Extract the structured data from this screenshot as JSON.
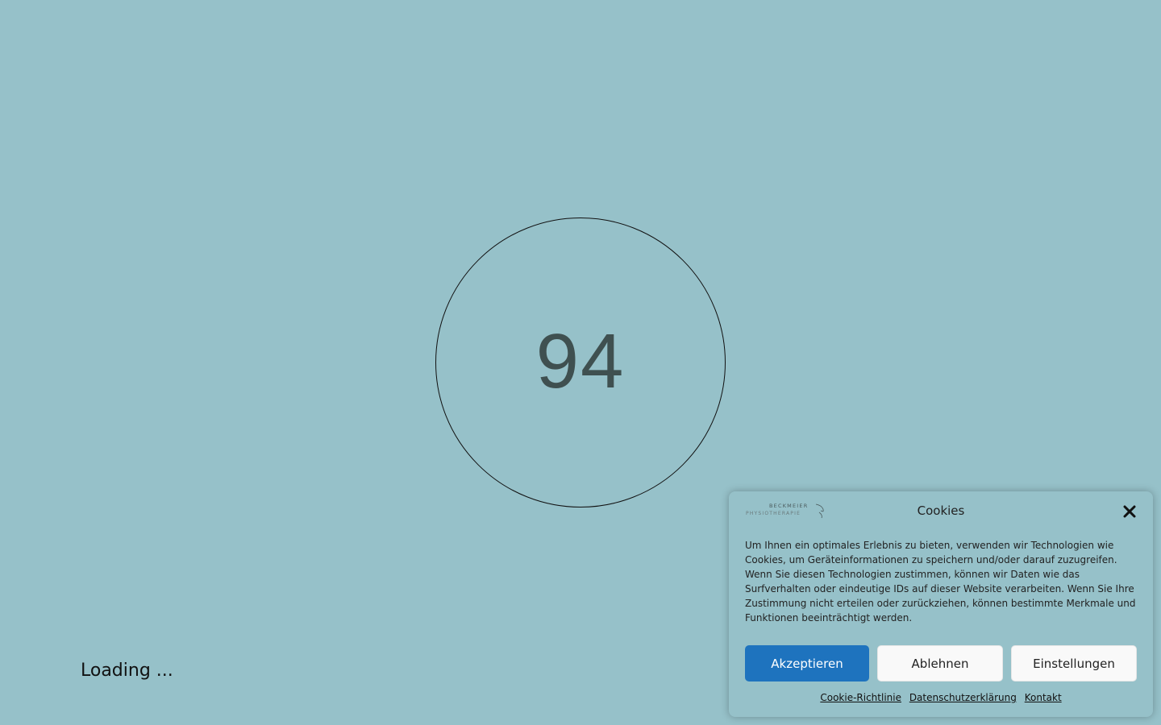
{
  "loader": {
    "percent": "94",
    "loading_text": "Loading ..."
  },
  "cookie_banner": {
    "logo_text_top": "BECKMEIER",
    "logo_text_bottom": "PHYSIOTHERAPIE",
    "title": "Cookies",
    "message": "Um Ihnen ein optimales Erlebnis zu bieten, verwenden wir Technologien wie Cookies, um Geräteinformationen zu speichern und/oder darauf zuzugreifen. Wenn Sie diesen Technologien zustimmen, können wir Daten wie das Surfverhalten oder eindeutige IDs auf dieser Website verarbeiten. Wenn Sie Ihre Zustimmung nicht erteilen oder zurückziehen, können bestimmte Merkmale und Funktionen beeinträchtigt werden.",
    "buttons": {
      "accept": "Akzeptieren",
      "deny": "Ablehnen",
      "settings": "Einstellungen"
    },
    "links": {
      "cookie_policy": "Cookie-Richtlinie",
      "privacy": "Datenschutzerklärung",
      "contact": "Kontakt"
    }
  },
  "colors": {
    "background": "#96c1c9",
    "accent": "#1e73be",
    "percent_text": "#3f5050"
  }
}
